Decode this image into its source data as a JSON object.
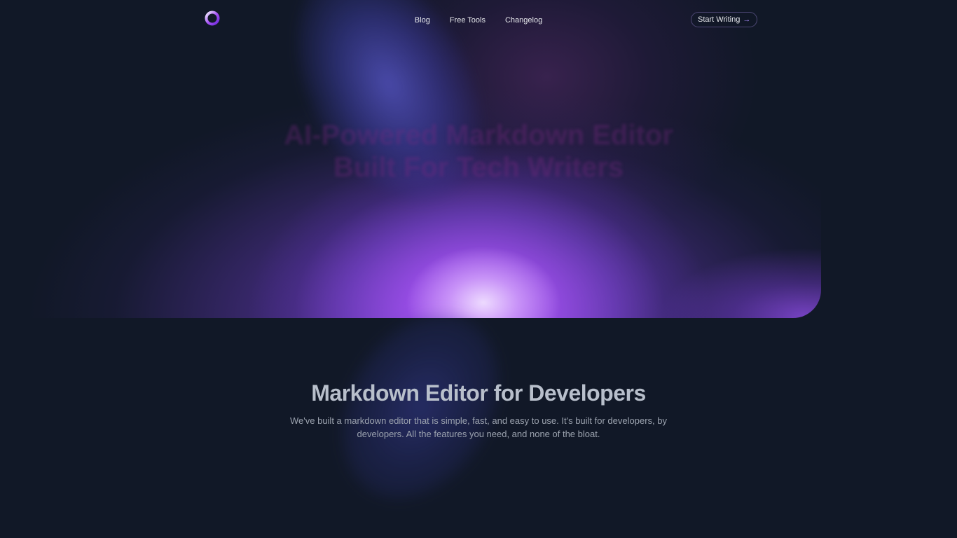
{
  "nav": {
    "logo_icon": "ring-logo-icon",
    "links": [
      {
        "label": "Blog"
      },
      {
        "label": "Free Tools"
      },
      {
        "label": "Changelog"
      }
    ],
    "cta": {
      "label": "Start Writing",
      "icon": "arrow-right-icon",
      "arrow": "→"
    }
  },
  "hero": {
    "background_heading": "AI-Powered Markdown Editor Built For Tech Writers"
  },
  "main": {
    "headline": "Markdown Editor for Developers",
    "subtext": "We've built a markdown editor that is simple, fast, and easy to use. It's built for developers, by developers. All the features you need, and none of the bloat."
  },
  "colors": {
    "background": "#111827",
    "accent": "#a855f7",
    "glow_core": "#e9d5ff"
  }
}
